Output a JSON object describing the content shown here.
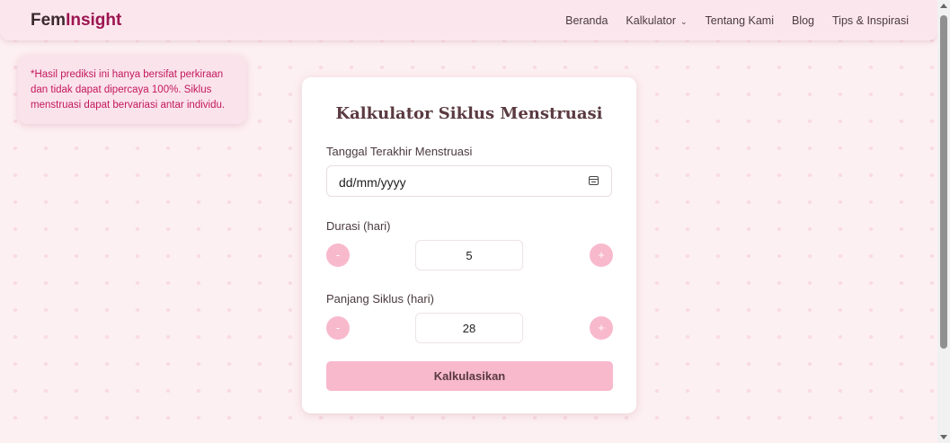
{
  "brand": {
    "part1": "Fem",
    "part2": "Insight"
  },
  "nav": {
    "items": [
      "Beranda",
      "Kalkulator",
      "Tentang Kami",
      "Blog",
      "Tips & Inspirasi"
    ],
    "dropdown_icon": "chevron-down-icon"
  },
  "note": {
    "text": "*Hasil prediksi ini hanya bersifat perkiraan dan tidak dapat dipercaya 100%. Siklus menstruasi dapat bervariasi antar individu."
  },
  "calculator": {
    "title": "Kalkulator Siklus Menstruasi",
    "last_period_label": "Tanggal Terakhir Menstruasi",
    "last_period_placeholder": "dd/mm/yyyy",
    "calendar_icon": "calendar-icon",
    "duration_label": "Durasi (hari)",
    "duration_value": "5",
    "cycle_label": "Panjang Siklus (hari)",
    "cycle_value": "28",
    "minus_label": "-",
    "plus_label": "+",
    "submit_label": "Kalkulasikan"
  },
  "colors": {
    "accent": "#f8b9cd",
    "brand": "#9c1450",
    "note_text": "#c2185b",
    "background": "#fdf0f2"
  }
}
